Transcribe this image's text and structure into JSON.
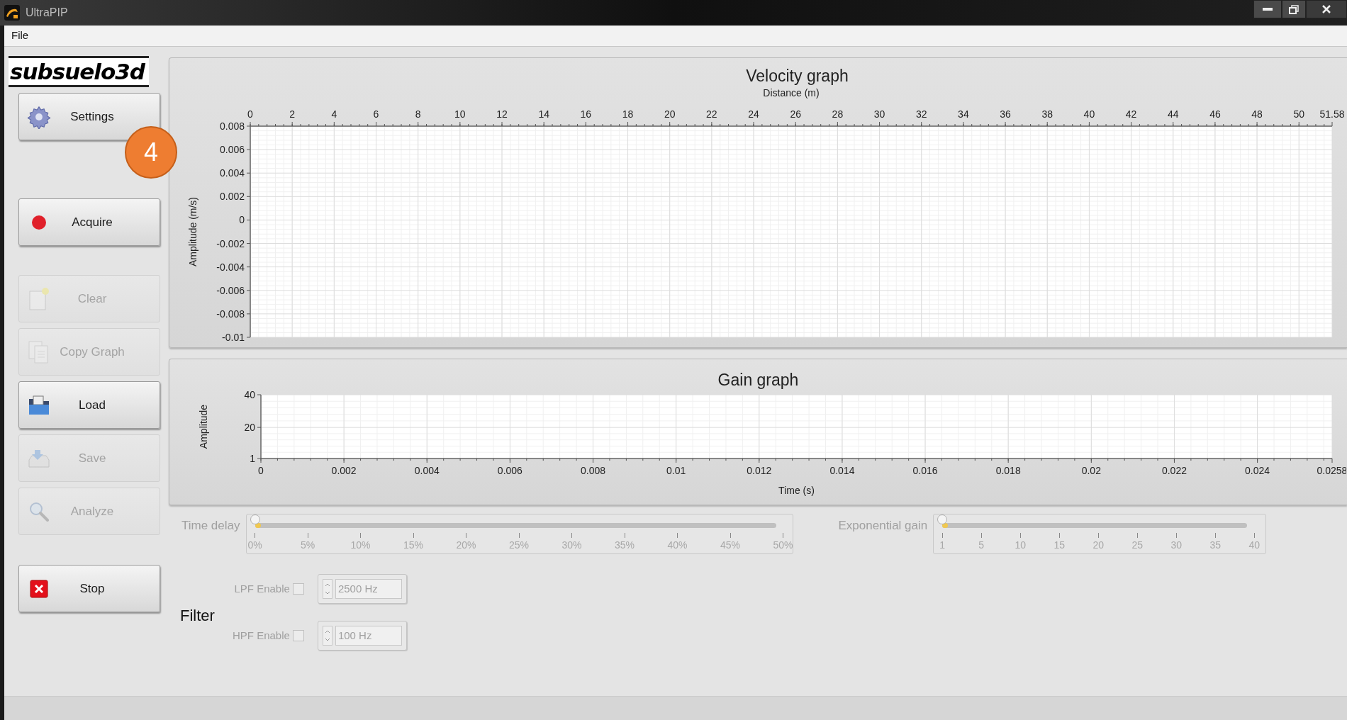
{
  "window": {
    "title": "UltraPIP"
  },
  "menu": [
    {
      "label": "File"
    }
  ],
  "logo": {
    "text": "subsuelo3d"
  },
  "annotation": {
    "label": "4"
  },
  "sidebar_buttons": [
    {
      "label": "Settings",
      "kind": "gear",
      "disabled": false
    },
    {
      "label": "Acquire",
      "kind": "record",
      "disabled": false
    },
    {
      "label": "Clear",
      "kind": "page",
      "disabled": true
    },
    {
      "label": "Copy Graph",
      "kind": "copy",
      "disabled": true
    },
    {
      "label": "Load",
      "kind": "folder",
      "disabled": false
    },
    {
      "label": "Save",
      "kind": "tray",
      "disabled": true
    },
    {
      "label": "Analyze",
      "kind": "magnifier",
      "disabled": true
    },
    {
      "label": "Stop",
      "kind": "stop",
      "disabled": false
    }
  ],
  "velocity_graph": {
    "chart_data": {
      "type": "line",
      "grid": true,
      "title": "Velocity graph",
      "xlabel": "Distance (m)",
      "ylabel": "Amplitude (m/s)",
      "xlim": [
        0,
        51.58
      ],
      "ylim": [
        -0.01,
        0.008
      ],
      "xticks": [
        0,
        2,
        4,
        6,
        8,
        10,
        12,
        14,
        16,
        18,
        20,
        22,
        24,
        26,
        28,
        30,
        32,
        34,
        36,
        38,
        40,
        42,
        44,
        46,
        48,
        50,
        51.58
      ],
      "yticks": [
        0.008,
        0.006,
        0.004,
        0.002,
        0,
        -0.002,
        -0.004,
        -0.006,
        -0.008,
        -0.01
      ]
    }
  },
  "gain_graph": {
    "chart_data": {
      "type": "line",
      "grid": true,
      "title": "Gain graph",
      "xlabel": "Time (s)",
      "ylabel": "Amplitude",
      "xlim": [
        0,
        0.0258
      ],
      "ylim": [
        1,
        40
      ],
      "xticks": [
        0,
        0.002,
        0.004,
        0.006,
        0.008,
        0.01,
        0.012,
        0.014,
        0.016,
        0.018,
        0.02,
        0.022,
        0.024,
        0.0258
      ],
      "yticks": [
        40,
        20,
        1
      ]
    }
  },
  "sliders": [
    {
      "label": "Time delay",
      "level": 0,
      "disabled": true,
      "scale": [
        "0%",
        "5%",
        "10%",
        "15%",
        "20%",
        "25%",
        "30%",
        "35%",
        "40%",
        "45%",
        "50%"
      ]
    },
    {
      "label": "Exponential gain",
      "level": 0,
      "disabled": true,
      "scale": [
        "1",
        "5",
        "10",
        "15",
        "20",
        "25",
        "30",
        "35",
        "40"
      ]
    }
  ],
  "filter": {
    "label": "Filter",
    "rows": [
      {
        "label": "LPF Enable",
        "checked": false,
        "disabled": true,
        "value": "2500 Hz"
      },
      {
        "label": "HPF Enable",
        "checked": false,
        "disabled": true,
        "value": "100 Hz"
      }
    ]
  }
}
